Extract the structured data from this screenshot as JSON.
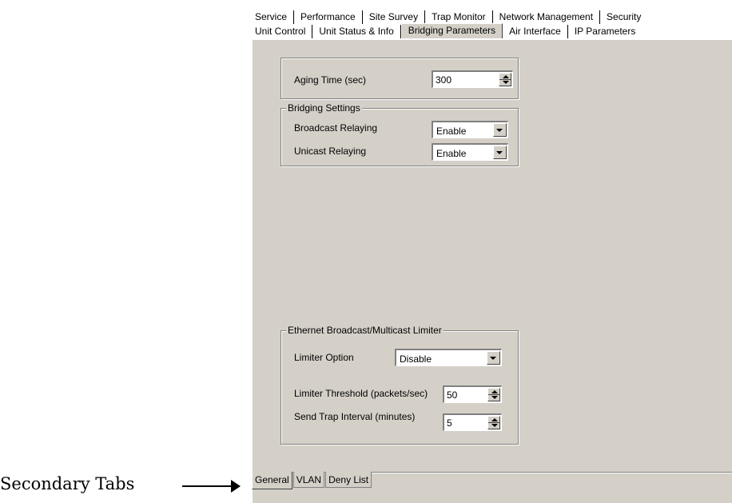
{
  "tabs": {
    "row1": [
      "Service",
      "Performance",
      "Site Survey",
      "Trap Monitor",
      "Network Management",
      "Security"
    ],
    "row2": [
      "Unit Control",
      "Unit Status & Info",
      "Bridging Parameters",
      "Air Interface",
      "IP Parameters"
    ],
    "active": "Bridging Parameters"
  },
  "aging": {
    "label": "Aging Time (sec)",
    "value": "300"
  },
  "bridging": {
    "legend": "Bridging Settings",
    "broadcast_label": "Broadcast Relaying",
    "broadcast_value": "Enable",
    "unicast_label": "Unicast Relaying",
    "unicast_value": "Enable"
  },
  "limiter": {
    "legend": "Ethernet Broadcast/Multicast Limiter",
    "option_label": "Limiter Option",
    "option_value": "Disable",
    "threshold_label": "Limiter Threshold (packets/sec)",
    "threshold_value": "50",
    "trap_label": "Send Trap Interval (minutes)",
    "trap_value": "5"
  },
  "secondary_tabs": [
    "General",
    "VLAN",
    "Deny List"
  ],
  "secondary_active": "General",
  "annotation": "Secondary Tabs"
}
